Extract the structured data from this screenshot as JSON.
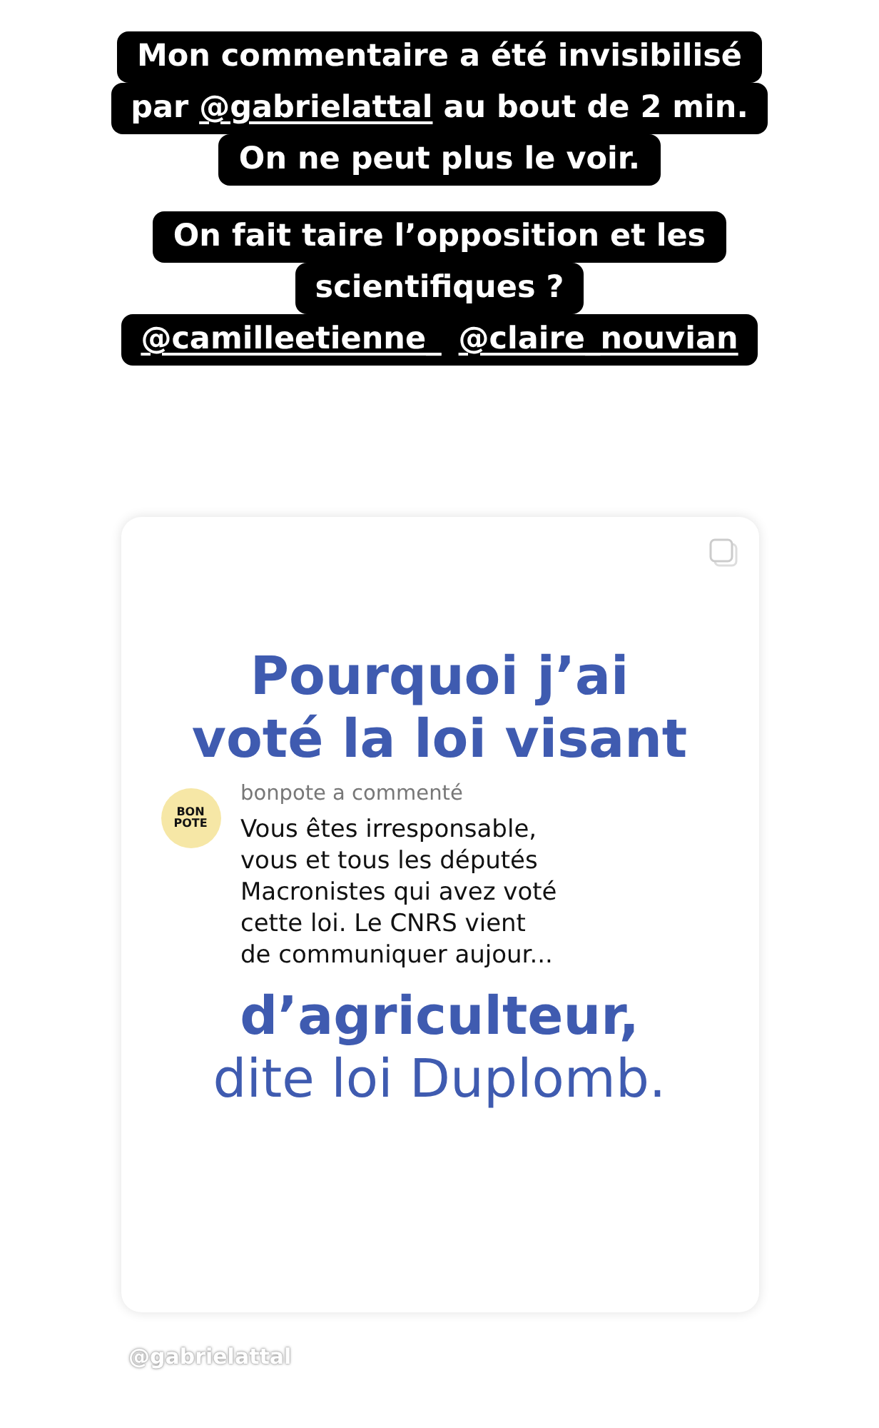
{
  "captions": [
    {
      "lines": [
        [
          {
            "kind": "plain",
            "text": "Mon commentaire a été invisibilisé"
          }
        ],
        [
          {
            "kind": "plain",
            "text": "par "
          },
          {
            "kind": "mention",
            "text": "@gabrielattal"
          },
          {
            "kind": "plain",
            "text": " au bout de 2 min."
          }
        ],
        [
          {
            "kind": "plain",
            "text": "On ne peut plus le voir."
          }
        ]
      ]
    },
    {
      "lines": [
        [
          {
            "kind": "plain",
            "text": "On fait taire l’opposition et les"
          }
        ],
        [
          {
            "kind": "plain",
            "text": "scientifiques ?"
          }
        ],
        [
          {
            "kind": "mention",
            "text": "@camilleetienne_"
          },
          {
            "kind": "mention",
            "text": "@claire_nouvian"
          }
        ]
      ]
    }
  ],
  "post": {
    "headline": [
      "Pourquoi j’ai",
      "voté la loi visant"
    ],
    "comment": {
      "avatar_text": "BON POTE",
      "author_line": "bonpote a commenté",
      "body": "Vous êtes irresponsable,\nvous et tous les députés\nMacronistes qui avez voté\ncette loi. Le CNRS vient\nde communiquer aujour..."
    },
    "headline_end_bold": "d’agriculteur,",
    "headline_end": "dite loi Duplomb."
  },
  "mention_sticker": "@gabrielattal"
}
